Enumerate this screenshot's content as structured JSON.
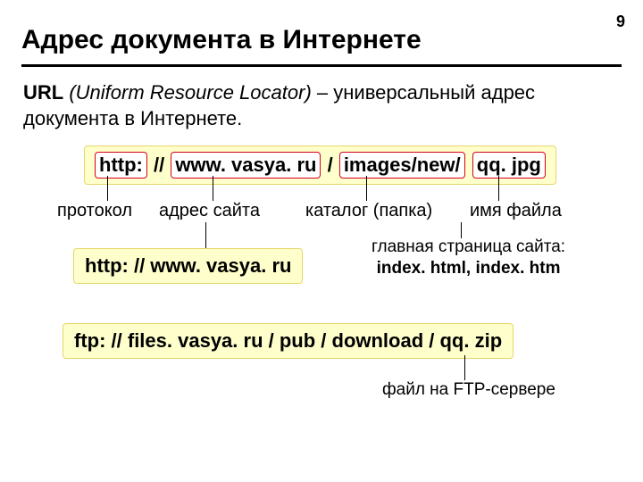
{
  "page_number": "9",
  "title": "Адрес документа в Интернете",
  "definition_bold": "URL",
  "definition_italic": "(Uniform Resource Locator)",
  "definition_rest": " – универсальный адрес документа в Интернете.",
  "url": {
    "protocol": "http:",
    "sep1": " // ",
    "site": "www. vasya. ru",
    "sep2": " / ",
    "folder": "images/new/",
    "sep3": " ",
    "file": "qq. jpg"
  },
  "labels": {
    "protocol": "протокол",
    "site": "адрес сайта",
    "folder": "каталог (папка)",
    "file": "имя файла"
  },
  "main_page_url": "http: // www. vasya. ru",
  "index_line1": "главная страница сайта:",
  "index_line2": "index. html, index. htm",
  "ftp_url": "ftp: // files. vasya. ru / pub / download / qq. zip",
  "ftp_label": "файл на FTP-сервере"
}
